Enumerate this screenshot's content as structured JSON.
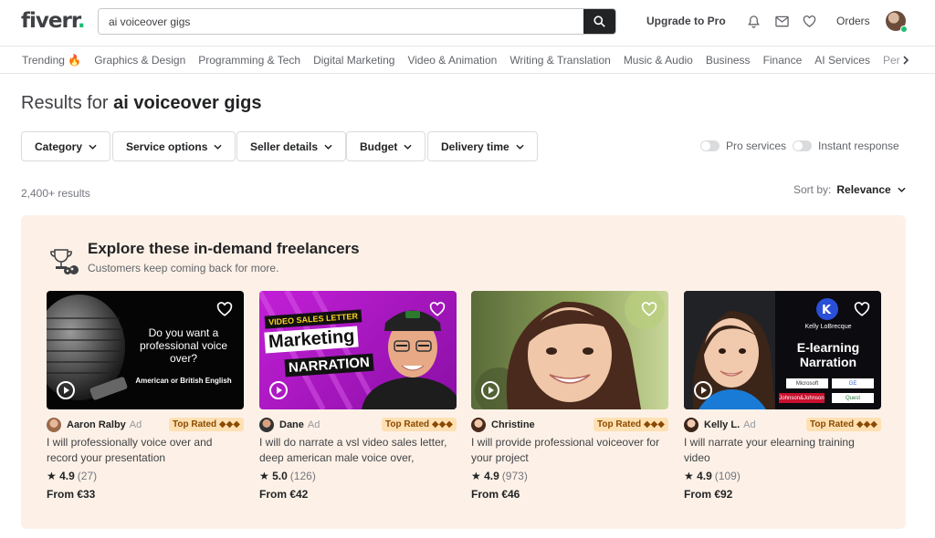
{
  "header": {
    "logo": "fiverr",
    "logo_dot": ".",
    "search_value": "ai voiceover gigs",
    "upgrade": "Upgrade to Pro",
    "orders": "Orders"
  },
  "categories": [
    "Trending 🔥",
    "Graphics & Design",
    "Programming & Tech",
    "Digital Marketing",
    "Video & Animation",
    "Writing & Translation",
    "Music & Audio",
    "Business",
    "Finance",
    "AI Services",
    "Per"
  ],
  "results": {
    "prefix": "Results for",
    "query": "ai voiceover gigs",
    "count": "2,400+ results",
    "sort_label": "Sort by:",
    "sort_value": "Relevance"
  },
  "filters": [
    "Category",
    "Service options",
    "Seller details",
    "Budget",
    "Delivery time"
  ],
  "toggles": {
    "pro": "Pro services",
    "instant": "Instant response"
  },
  "promo": {
    "title": "Explore these in-demand freelancers",
    "subtitle": "Customers keep coming back for more."
  },
  "cards": [
    {
      "seller": "Aaron Ralby",
      "ad": "Ad",
      "badge": "Top Rated ◆◆◆",
      "title": "I will professionally voice over and record your presentation",
      "rating": "4.9",
      "reviews": "(27)",
      "price": "From €33",
      "thumb_lines": [
        "Do you want a",
        "professional voice",
        "over?"
      ],
      "thumb_sub": "American or British English"
    },
    {
      "seller": "Dane",
      "ad": "Ad",
      "badge": "Top Rated ◆◆◆",
      "title": "I will do narrate a vsl video sales letter, deep american male voice over, human...",
      "rating": "5.0",
      "reviews": "(126)",
      "price": "From €42",
      "thumb_lines": [
        "VIDEO SALES LETTER",
        "Marketing",
        "NARRATION"
      ]
    },
    {
      "seller": "Christine",
      "ad": "",
      "badge": "Top Rated ◆◆◆",
      "title": "I will provide professional voiceover for your project",
      "rating": "4.9",
      "reviews": "(973)",
      "price": "From €46"
    },
    {
      "seller": "Kelly L.",
      "ad": "Ad",
      "badge": "Top Rated ◆◆◆",
      "title": "I will narrate your elearning training video",
      "rating": "4.9",
      "reviews": "(109)",
      "price": "From €92",
      "thumb_lines": [
        "E-learning",
        "Narration"
      ],
      "thumb_sub": "Kelly LoBrecque",
      "thumb_logos": [
        "Microsoft",
        "Quest",
        "Johnson&Johnson",
        "GE"
      ]
    }
  ]
}
